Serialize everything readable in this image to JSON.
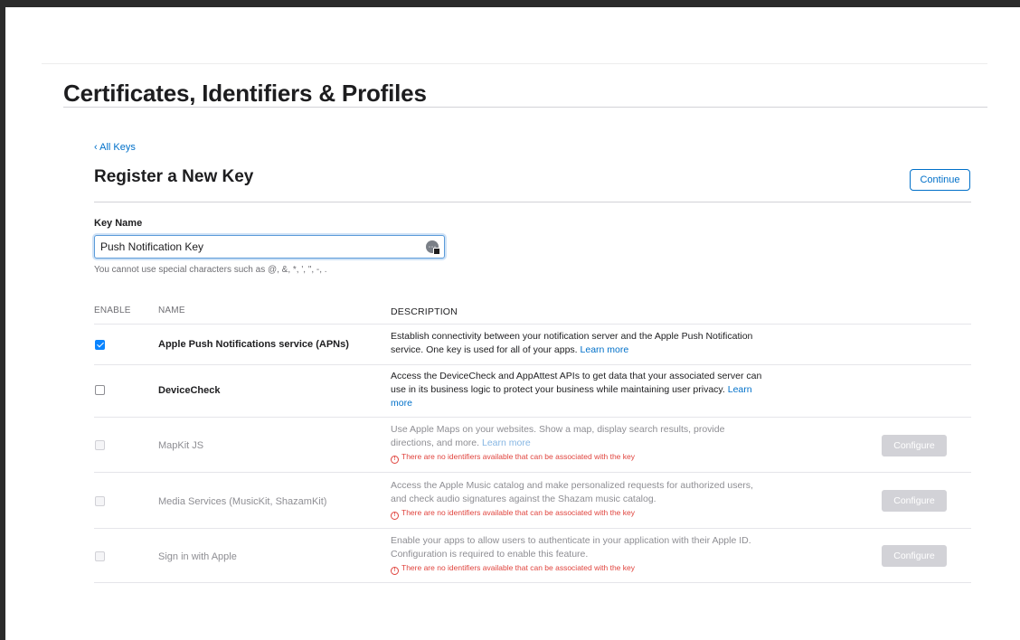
{
  "header": {
    "title": "Certificates, Identifiers & Profiles"
  },
  "nav": {
    "back_label": "‹ All Keys"
  },
  "section": {
    "title": "Register a New Key",
    "continue_label": "Continue"
  },
  "key_name": {
    "label": "Key Name",
    "value": "Push Notification Key",
    "helper": "You cannot use special characters such as @, &, *, ', \", -, ."
  },
  "table": {
    "headers": {
      "enable": "ENABLE",
      "name": "NAME",
      "description": "DESCRIPTION"
    },
    "rows": [
      {
        "name": "Apple Push Notifications service (APNs)",
        "description": "Establish connectivity between your notification server and the Apple Push Notification service. One key is used for all of your apps.",
        "learn_more": "Learn more",
        "checked": true,
        "enabled": true
      },
      {
        "name": "DeviceCheck",
        "description": "Access the DeviceCheck and AppAttest APIs to get data that your associated server can use in its business logic to protect your business while maintaining user privacy.",
        "learn_more": "Learn more",
        "checked": false,
        "enabled": true
      },
      {
        "name": "MapKit JS",
        "description": "Use Apple Maps on your websites. Show a map, display search results, provide directions, and more.",
        "learn_more": "Learn more",
        "warning": "There are no identifiers available that can be associated with the key",
        "button": "Configure",
        "checked": false,
        "enabled": false
      },
      {
        "name": "Media Services (MusicKit, ShazamKit)",
        "description": "Access the Apple Music catalog and make personalized requests for authorized users, and check audio signatures against the Shazam music catalog.",
        "warning": "There are no identifiers available that can be associated with the key",
        "button": "Configure",
        "checked": false,
        "enabled": false
      },
      {
        "name": "Sign in with Apple",
        "description": "Enable your apps to allow users to authenticate in your application with their Apple ID. Configuration is required to enable this feature.",
        "warning": "There are no identifiers available that can be associated with the key",
        "button": "Configure",
        "checked": false,
        "enabled": false
      }
    ]
  },
  "icons": {
    "input_icon": "password-manager-icon",
    "warning_icon": "exclamation-circle-icon",
    "check_icon": "checkmark-icon"
  },
  "colors": {
    "accent": "#0070c9",
    "checkbox_checked": "#0a84ff",
    "warning": "#e0443e",
    "disabled_button": "#d2d2d7"
  }
}
